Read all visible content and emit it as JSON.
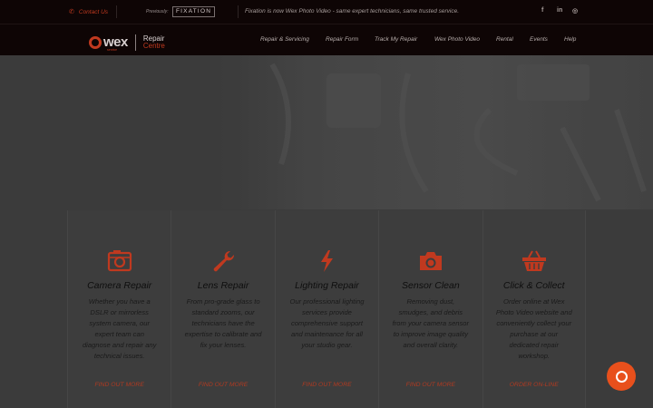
{
  "topbar": {
    "contact_label": "Contact Us",
    "previously_label": "Previously:",
    "fixation_logo": "FIXATION",
    "notice": "Fixation is now Wex Photo Video - same expert technicians, same trusted service.",
    "social": [
      {
        "icon": "facebook-icon",
        "glyph": "f"
      },
      {
        "icon": "linkedin-icon",
        "glyph": "in"
      },
      {
        "icon": "instagram-icon",
        "glyph": "◎"
      }
    ]
  },
  "navbar": {
    "logo": {
      "brand": "wex",
      "sub": "service",
      "line1": "Repair",
      "line2": "Centre"
    },
    "items": [
      "Repair & Servicing",
      "Repair Form",
      "Track My Repair",
      "Wex Photo Video",
      "Rental",
      "Events",
      "Help"
    ]
  },
  "cards": [
    {
      "icon": "camera-box-icon",
      "title": "Camera Repair",
      "desc": "Whether you have a DSLR or mirrorless system camera, our expert team can diagnose and repair any technical issues.",
      "link": "FIND OUT MORE"
    },
    {
      "icon": "wrench-icon",
      "title": "Lens Repair",
      "desc": "From pro-grade glass to standard zooms, our technicians have the expertise to calibrate and fix your lenses.",
      "link": "FIND OUT MORE"
    },
    {
      "icon": "lightning-icon",
      "title": "Lighting Repair",
      "desc": "Our professional lighting services provide comprehensive support and maintenance for all your studio gear.",
      "link": "FIND OUT MORE"
    },
    {
      "icon": "camera-icon",
      "title": "Sensor Clean",
      "desc": "Removing dust, smudges, and debris from your camera sensor to improve image quality and overall clarity.",
      "link": "FIND OUT MORE"
    },
    {
      "icon": "basket-icon",
      "title": "Click & Collect",
      "desc": "Order online at Wex Photo Video website and conveniently collect your purchase at our dedicated repair workshop.",
      "link": "ORDER ON-LINE"
    }
  ],
  "colors": {
    "accent": "#c0391f",
    "help_bubble": "#e8501c",
    "header_bg": "#0e0505"
  }
}
